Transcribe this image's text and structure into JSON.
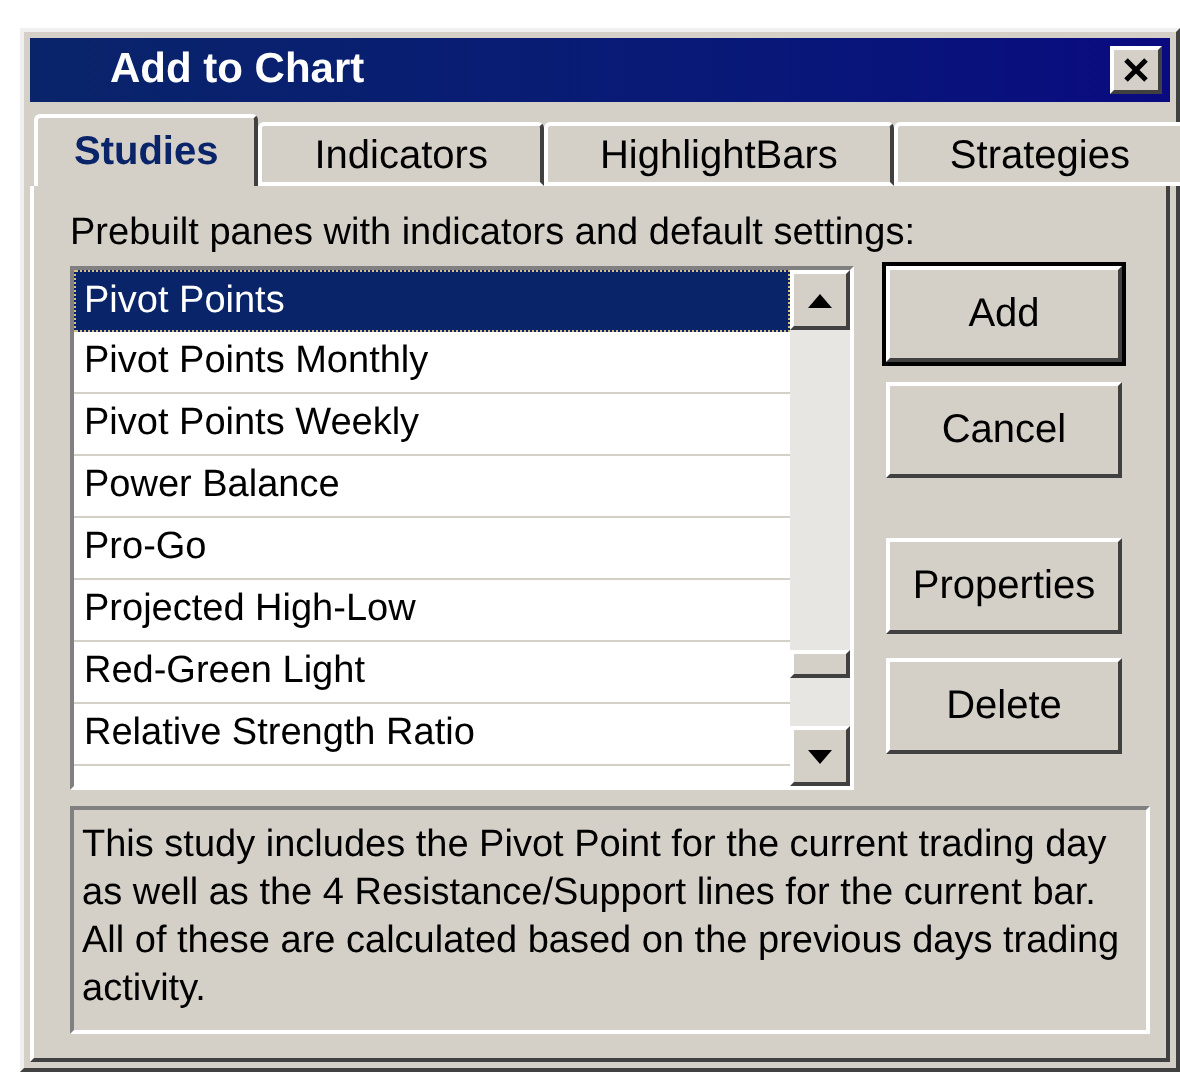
{
  "window": {
    "title": "Add to Chart"
  },
  "tabs": [
    {
      "label": "Studies",
      "selected": true
    },
    {
      "label": "Indicators",
      "selected": false
    },
    {
      "label": "HighlightBars",
      "selected": false
    },
    {
      "label": "Strategies",
      "selected": false
    }
  ],
  "list_label": "Prebuilt panes with indicators and default settings:",
  "studies": [
    {
      "label": "Pivot Points",
      "selected": true
    },
    {
      "label": "Pivot Points Monthly",
      "selected": false
    },
    {
      "label": "Pivot Points Weekly",
      "selected": false
    },
    {
      "label": "Power Balance",
      "selected": false
    },
    {
      "label": "Pro-Go",
      "selected": false
    },
    {
      "label": "Projected High-Low",
      "selected": false
    },
    {
      "label": "Red-Green Light",
      "selected": false
    },
    {
      "label": "Relative Strength Ratio",
      "selected": false
    }
  ],
  "buttons": [
    {
      "label": "Add",
      "default": true
    },
    {
      "label": "Cancel",
      "default": false
    },
    {
      "label": "Properties",
      "default": false
    },
    {
      "label": "Delete",
      "default": false
    }
  ],
  "description": "This study includes the Pivot Point for the current trading day as well as the 4 Resistance/Support lines for the current bar.  All of these are calculated based on the previous days trading activity."
}
